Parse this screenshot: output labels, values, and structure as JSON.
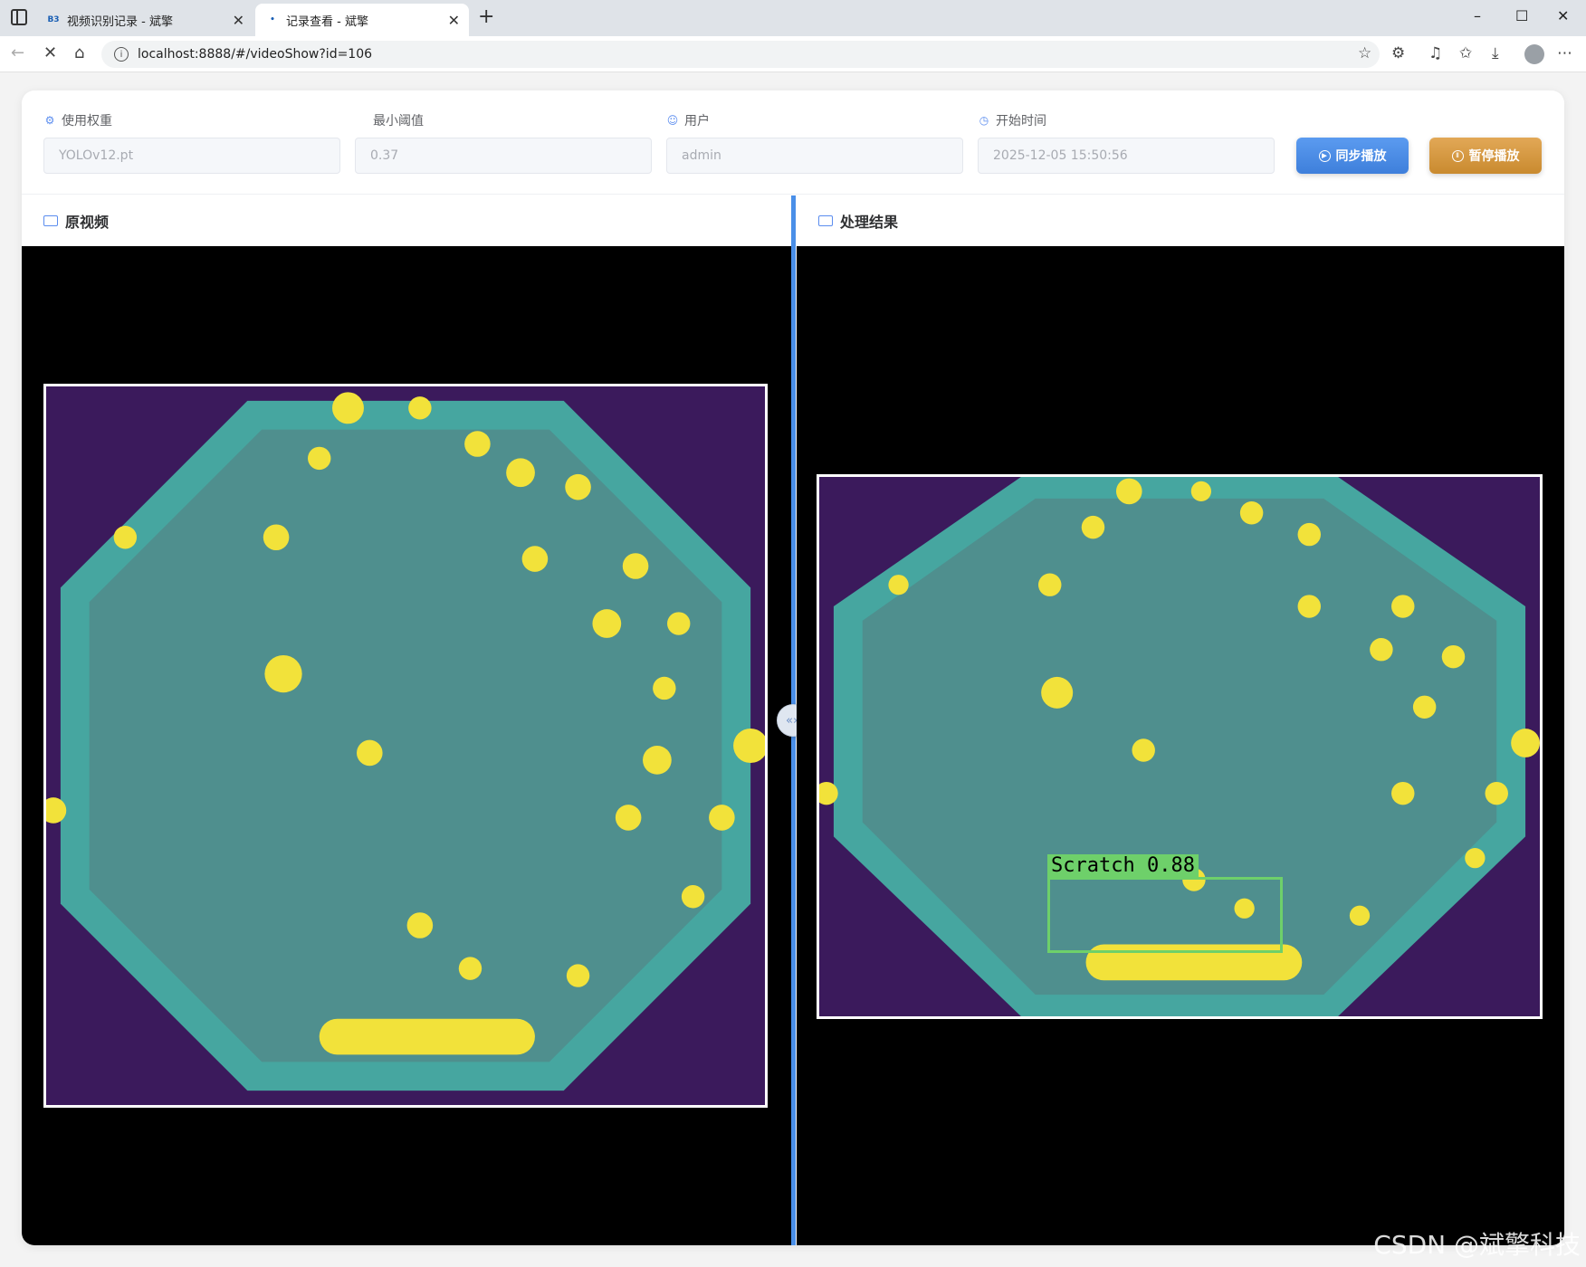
{
  "browser": {
    "tabs": [
      {
        "favicon": "B3",
        "title": "视频识别记录 - 斌擎",
        "active": false
      },
      {
        "favicon": "•",
        "title": "记录查看 - 斌擎",
        "active": true
      }
    ],
    "url": "localhost:8888/#/videoShow?id=106"
  },
  "form": {
    "weight": {
      "label": "使用权重",
      "value": "YOLOv12.pt",
      "icon": "gear-icon"
    },
    "threshold": {
      "label": "最小阈值",
      "value": "0.37"
    },
    "user": {
      "label": "用户",
      "value": "admin",
      "icon": "user-icon"
    },
    "start_time": {
      "label": "开始时间",
      "value": "2025-12-05 15:50:56",
      "icon": "clock-icon"
    },
    "sync_button": "同步播放",
    "pause_button": "暂停播放"
  },
  "panes": {
    "original_title": "原视频",
    "result_title": "处理结果"
  },
  "detection": {
    "label": "Scratch",
    "confidence": "0.88",
    "color": "#6ed06a"
  },
  "watermark": "CSDN @斌擎科技",
  "colors": {
    "accent": "#4a8fe8",
    "sync_button": "#3e7fdb",
    "pause_button": "#c98a2f",
    "video_bg": "#000000"
  }
}
